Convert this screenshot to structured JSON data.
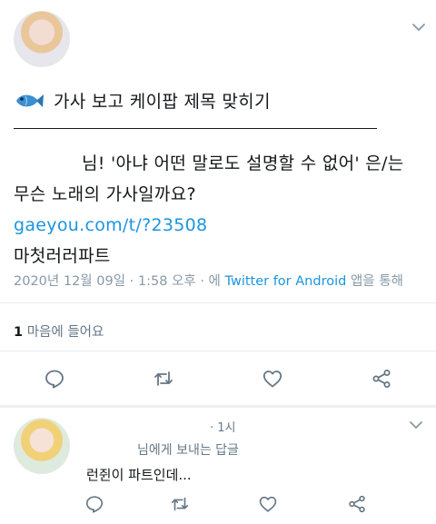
{
  "tweet": {
    "title_line": "가사 보고 케이팝 제목 맞히기",
    "body_line1": "님! '아냐 어떤 말로도 설명할 수 없어' 은/는",
    "body_line2": "무슨 노래의 가사일까요?",
    "link": "gaeyou.com/t/?23508",
    "answer": "마첫러러파트",
    "timestamp": "2020년 12월 09일 · 1:58 오후 · 에",
    "via": "Twitter for Android",
    "via_suffix": "앱을 통해",
    "likes_count": "1",
    "likes_label": "마음에 들어요"
  },
  "reply": {
    "time": "· 1시",
    "replying_to": "님에게 보내는 답글",
    "text": "런쥔이 파트인데..."
  },
  "colors": {
    "text": "#14171a",
    "secondary": "#657786",
    "meta": "#8899a6",
    "link": "#1b95e0",
    "divider": "#e6ecf0"
  },
  "icons": [
    "fish-emoji-icon",
    "chevron-down-icon",
    "reply-icon",
    "retweet-icon",
    "like-icon",
    "share-icon"
  ]
}
